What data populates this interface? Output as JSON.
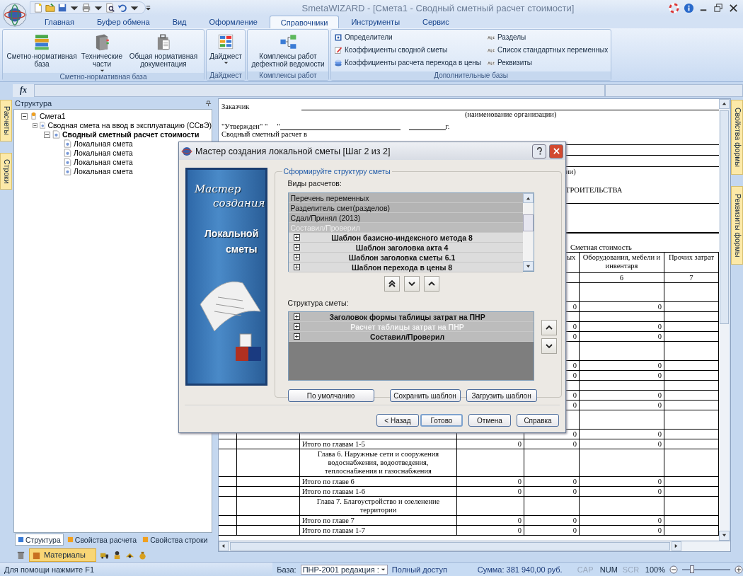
{
  "window": {
    "title": "SmetaWIZARD - [Смета1 - Сводный сметный расчет стоимости]"
  },
  "ribbon_tabs": [
    {
      "label": "Главная",
      "selected": false
    },
    {
      "label": "Буфер обмена",
      "selected": false
    },
    {
      "label": "Вид",
      "selected": false
    },
    {
      "label": "Оформление",
      "selected": false
    },
    {
      "label": "Справочники",
      "selected": true
    },
    {
      "label": "Инструменты",
      "selected": false
    },
    {
      "label": "Сервис",
      "selected": false
    }
  ],
  "ribbon_groups": [
    {
      "label": "Сметно-нормативная база",
      "buttons": [
        {
          "label": "Сметно-нормативная база",
          "menu": false
        },
        {
          "label": "Технические части",
          "menu": true
        },
        {
          "label": "Общая нормативная документация",
          "menu": false
        }
      ]
    },
    {
      "label": "Дайджест",
      "buttons": [
        {
          "label": "Дайджест",
          "menu": true
        }
      ]
    },
    {
      "label": "Комплексы работ",
      "buttons": [
        {
          "label": "Комплексы работ дефектной ведомости",
          "menu": false
        }
      ]
    }
  ],
  "extra_group": {
    "label": "Дополнительные базы",
    "items": [
      "Определители",
      "Коэффициенты сводной сметы",
      "Коэффициенты расчета перехода в цены",
      "Разделы",
      "Список стандартных переменных",
      "Реквизиты"
    ]
  },
  "formula_bar": {
    "label": "fx"
  },
  "side_tabs_left": [
    "Расчеты",
    "Строки"
  ],
  "side_tabs_right": [
    "Свойства формы",
    "Реквизиты формы"
  ],
  "structure_panel": {
    "title": "Структура",
    "tree": [
      {
        "label": "Смета1",
        "selected": false,
        "expanded": true,
        "children": [
          {
            "label": "Сводная смета на ввод в эксплуатацию (ССвЭ)",
            "selected": false,
            "expanded": true,
            "children": [
              {
                "label": "Сводный сметный расчет стоимости",
                "selected": true,
                "expanded": true,
                "children": [
                  {
                    "label": "Локальная смета",
                    "selected": false
                  },
                  {
                    "label": "Локальная смета",
                    "selected": false
                  },
                  {
                    "label": "Локальная смета",
                    "selected": false
                  },
                  {
                    "label": "Локальная смета",
                    "selected": false
                  }
                ]
              }
            ]
          }
        ]
      }
    ]
  },
  "panel_tabs": [
    {
      "label": "Структура",
      "selected": true
    },
    {
      "label": "Свойства расчета",
      "selected": false
    },
    {
      "label": "Свойства строки",
      "selected": false
    }
  ],
  "materials_button": {
    "label": "Материалы",
    "selected": true
  },
  "document": {
    "customer_label": "Заказчик",
    "org_caption": "(наименование организации)",
    "approved": "\"Утвержден\" \"     \"",
    "year_suffix": "г.",
    "title_line": "Сводный сметный расчет в",
    "fragment_1": "ии)",
    "fragment_2": "ТРОИТЕЛЬСТВА",
    "cost_header": "Сметная стоимость",
    "columns": [
      "ых",
      "Оборудования, мебели и инвентаря",
      "Прочих затрат"
    ],
    "column_numbers": [
      "6",
      "7"
    ],
    "rows": [
      {
        "kind": "heading"
      },
      {
        "kind": "sum",
        "values": [
          "0",
          "0"
        ]
      },
      {
        "kind": "blank"
      },
      {
        "kind": "sum",
        "values": [
          "0",
          "0"
        ]
      },
      {
        "kind": "sum",
        "values": [
          "0",
          "0"
        ]
      },
      {
        "kind": "heading"
      },
      {
        "kind": "sum",
        "values": [
          "0",
          "0"
        ]
      },
      {
        "kind": "sum",
        "values": [
          "0",
          "0"
        ]
      },
      {
        "kind": "blank"
      },
      {
        "kind": "sum",
        "values": [
          "0",
          "0"
        ]
      },
      {
        "kind": "sum",
        "values": [
          "0",
          "0"
        ]
      },
      {
        "kind": "heading"
      },
      {
        "kind": "sum",
        "values": [
          "0",
          "0"
        ]
      },
      {
        "kind": "sum",
        "label": "Итого по главам 1-5",
        "values": [
          "0",
          "0",
          "0"
        ]
      },
      {
        "kind": "heading",
        "label": "Глава 6. Наружные сети и сооружения водоснабжения, водоотведения, теплоснабжения и газоснабжения"
      },
      {
        "kind": "sum",
        "label": "Итого по главе 6",
        "values": [
          "0",
          "0",
          "0"
        ]
      },
      {
        "kind": "sum",
        "label": "Итого по главам 1-6",
        "values": [
          "0",
          "0",
          "0"
        ]
      },
      {
        "kind": "heading",
        "label": "Глава 7. Благоустройство и озеленение территории"
      },
      {
        "kind": "sum",
        "label": "Итого по главе 7",
        "values": [
          "0",
          "0",
          "0"
        ]
      },
      {
        "kind": "sum",
        "label": "Итого по главам 1-7",
        "values": [
          "0",
          "0",
          "0"
        ]
      }
    ]
  },
  "dialog": {
    "title": "Мастер создания локальной сметы [Шаг 2 из 2]",
    "banner": [
      "Мастер",
      "создания",
      "Локальной",
      "сметы"
    ],
    "group_label": "Сформируйте структуру сметы",
    "available_label": "Виды расчетов:",
    "available": [
      {
        "label": "Перечень переменных",
        "kind": "plain",
        "disabled": false
      },
      {
        "label": "Разделитель смет(разделов)",
        "kind": "plain",
        "disabled": false
      },
      {
        "label": "Сдал/Принял (2013)",
        "kind": "plain",
        "disabled": false
      },
      {
        "label": "Составил/Проверил",
        "kind": "plain",
        "disabled": true
      },
      {
        "label": "Шаблон базисно-индексного метода 8",
        "kind": "group",
        "disabled": false
      },
      {
        "label": "Шаблон заголовка акта 4",
        "kind": "group",
        "disabled": false
      },
      {
        "label": "Шаблон заголовка сметы 6.1",
        "kind": "group",
        "disabled": false
      },
      {
        "label": "Шаблон перехода в цены 8",
        "kind": "group",
        "disabled": false
      }
    ],
    "structure_label": "Структура сметы:",
    "structure": [
      {
        "label": "Заголовок формы таблицы затрат на ПНР",
        "disabled": false
      },
      {
        "label": "Расчет таблицы затрат на ПНР",
        "disabled": true
      },
      {
        "label": "Составил/Проверил",
        "disabled": false
      }
    ],
    "template_buttons": [
      "По умолчанию",
      "Сохранить шаблон",
      "Загрузить шаблон"
    ],
    "nav_buttons": [
      {
        "label": "< Назад",
        "selected": false
      },
      {
        "label": "Готово",
        "selected": true
      },
      {
        "label": "Отмена",
        "selected": false
      },
      {
        "label": "Справка",
        "selected": false
      }
    ]
  },
  "status_bar": {
    "help": "Для помощи нажмите F1",
    "base_label": "База:",
    "base_value": "ПНР-2001 редакция :",
    "access": "Полный доступ",
    "sum": "Сумма: 381 940,00 руб.",
    "indicators": [
      {
        "label": "CAP",
        "on": false
      },
      {
        "label": "NUM",
        "on": true
      },
      {
        "label": "SCR",
        "on": false
      }
    ],
    "zoom": "100%",
    "zoom_slider": {
      "level": 0.2
    }
  }
}
